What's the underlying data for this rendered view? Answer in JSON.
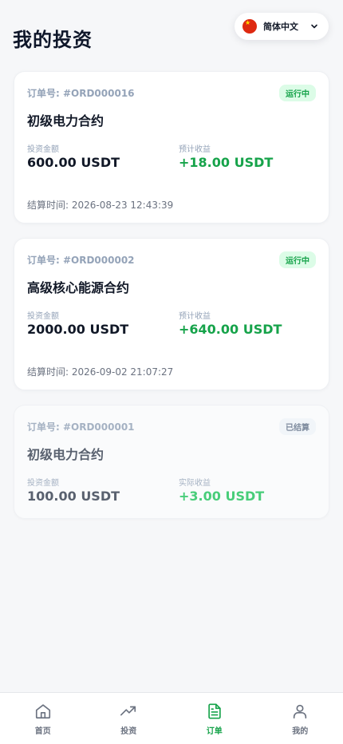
{
  "header": {
    "title": "我的投资",
    "language": {
      "label": "简体中文",
      "flag_icon": "china-flag-icon"
    }
  },
  "orders": [
    {
      "order_no": "订单号: #ORD000016",
      "status": "运行中",
      "name": "初级电力合约",
      "amount_label": "投资金额",
      "amount": "600.00 USDT",
      "profit_label": "预计收益",
      "profit": "+18.00 USDT",
      "settle_time": "结算时间: 2026-08-23 12:43:39"
    },
    {
      "order_no": "订单号: #ORD000002",
      "status": "运行中",
      "name": "高级核心能源合约",
      "amount_label": "投资金额",
      "amount": "2000.00 USDT",
      "profit_label": "预计收益",
      "profit": "+640.00 USDT",
      "settle_time": "结算时间: 2026-09-02 21:07:27"
    },
    {
      "order_no": "订单号: #ORD000001",
      "status": "已结算",
      "name": "初级电力合约",
      "amount_label": "投资金额",
      "amount": "100.00 USDT",
      "profit_label": "实际收益",
      "profit": "+3.00 USDT"
    }
  ],
  "nav": [
    {
      "label": "首页",
      "icon": "home-icon"
    },
    {
      "label": "投资",
      "icon": "trending-up-icon"
    },
    {
      "label": "订单",
      "icon": "document-icon",
      "active": true
    },
    {
      "label": "我的",
      "icon": "user-icon"
    }
  ],
  "colors": {
    "accent": "#16a34a",
    "running_bg": "#dcfce7",
    "muted": "#94a3b8"
  }
}
